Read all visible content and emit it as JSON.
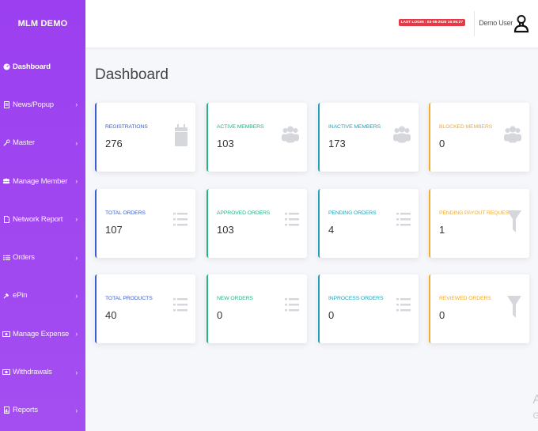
{
  "brand": "MLM DEMO",
  "sidebar": {
    "items": [
      {
        "label": "Dashboard",
        "icon": "dashboard-icon",
        "active": true,
        "chevron": ""
      },
      {
        "label": "News/Popup",
        "icon": "news-icon",
        "chevron": "›"
      },
      {
        "label": "Master",
        "icon": "wrench-icon",
        "chevron": "›"
      },
      {
        "label": "Manage Member",
        "icon": "members-icon",
        "chevron": "›"
      },
      {
        "label": "Network Report",
        "icon": "file-icon",
        "chevron": "›"
      },
      {
        "label": "Orders",
        "icon": "list-icon",
        "chevron": "›"
      },
      {
        "label": "ePin",
        "icon": "pin-icon",
        "chevron": "›"
      },
      {
        "label": "Manage Expense",
        "icon": "money-icon",
        "chevron": "›"
      },
      {
        "label": "Withdrawals",
        "icon": "cash-icon",
        "chevron": "›"
      },
      {
        "label": "Reports",
        "icon": "report-icon",
        "chevron": "›"
      }
    ]
  },
  "topbar": {
    "last_login": "LAST LOGIN : 03-08-2020 16:05:27",
    "user_name": "Demo User"
  },
  "page": {
    "title": "Dashboard"
  },
  "cards": [
    {
      "label": "REGISTRATIONS",
      "value": "276",
      "icon": "calendar-icon"
    },
    {
      "label": "ACTIVE MEMBERS",
      "value": "103",
      "icon": "users-icon"
    },
    {
      "label": "INACTIVE MEMBERS",
      "value": "173",
      "icon": "users-icon"
    },
    {
      "label": "BLOCKED MEMBERS",
      "value": "0",
      "icon": "users-icon"
    },
    {
      "label": "TOTAL ORDERS",
      "value": "107",
      "icon": "list-icon"
    },
    {
      "label": "APPROVED ORDERS",
      "value": "103",
      "icon": "list-icon"
    },
    {
      "label": "PENDING ORDERS",
      "value": "4",
      "icon": "list-icon"
    },
    {
      "label": "PENDING PAYOUT REQUEST",
      "value": "1",
      "icon": "filter-icon"
    },
    {
      "label": "TOTAL PRODUCTS",
      "value": "40",
      "icon": "list-icon"
    },
    {
      "label": "NEW ORDERS",
      "value": "0",
      "icon": "list-icon"
    },
    {
      "label": "INPROCESS ORDERS",
      "value": "0",
      "icon": "list-icon"
    },
    {
      "label": "REVIEWED ORDERS",
      "value": "0",
      "icon": "filter-icon"
    }
  ],
  "colors": {
    "sidebar": "#9b3ff0",
    "blue": "#3b5fd0",
    "green": "#26b57f",
    "teal": "#22a3b8",
    "orange": "#f0ad2e",
    "last_login_badge": "#e63946"
  },
  "watermark": {
    "line1": "A",
    "line2": "G"
  }
}
